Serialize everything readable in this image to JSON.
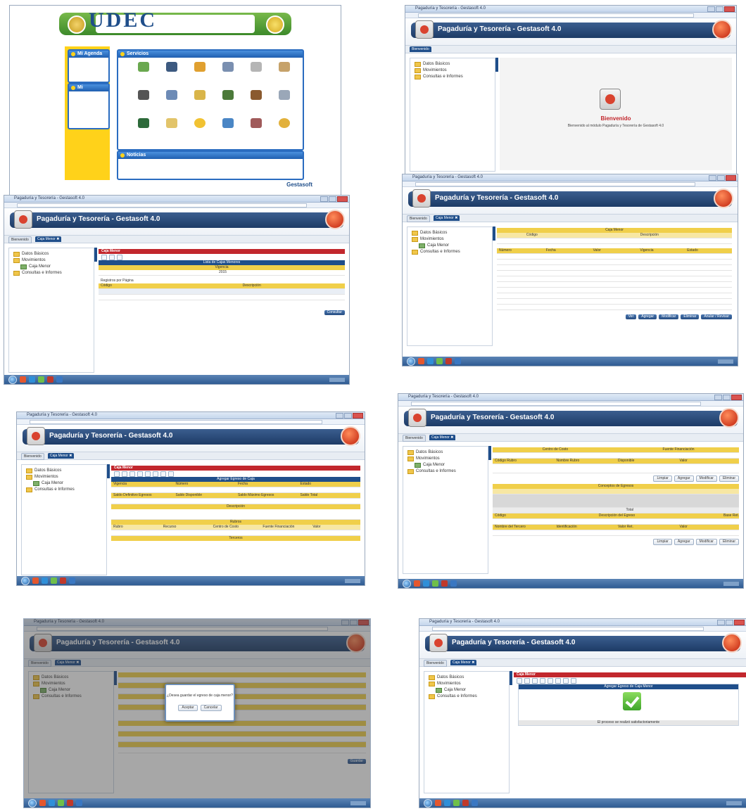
{
  "shot1": {
    "logo_text": "UDEC",
    "portlet_agenda": "Mi Agenda",
    "portlet_calendar": "Mi Calendario",
    "portlet_services": "Servicios",
    "portlet_notices": "Noticias",
    "footer_brand": "Gestasoft",
    "tiles": [
      "",
      "",
      "",
      "",
      "",
      "",
      "",
      "",
      "",
      "",
      "",
      "",
      "",
      "",
      "",
      "",
      "",
      ""
    ]
  },
  "app": {
    "title": "Pagaduría y Tesorería - Gestasoft 4.0",
    "tab_bienvenido": "Bienvenido",
    "tab_caja_menor": "Caja Menor ✖",
    "tree": [
      "Datos Básicos",
      "Movimientos",
      "Caja Menor",
      "Consultas e Informes"
    ]
  },
  "shot2": {
    "welcome_title": "Bienvenido",
    "welcome_text": "Bienvenido al módulo Pagaduría y Tesorería de Gestasoft 4.0"
  },
  "shot3": {
    "band": "Caja Menor",
    "list_title": "Lista de Cajas Menores",
    "col_vigencia": "Vigencia",
    "vigencia_value": "2015",
    "col_codigo": "Código",
    "col_descripcion": "Descripción",
    "registros_label": "Registros por Página",
    "btn_consultar": "Consultar"
  },
  "shot4": {
    "band": "Caja Menor",
    "col_codigo": "Código",
    "col_descripcion": "Descripción",
    "table_headers": [
      "Número",
      "Fecha",
      "Valor",
      "Vigencia",
      "Estado"
    ],
    "buttons": [
      "Ver",
      "Agregar",
      "Modificar",
      "Eliminar",
      "Anular / Revisar"
    ]
  },
  "shot5": {
    "band": "Caja Menor",
    "form_title": "Agregar Egreso de Caja",
    "headers1": [
      "Vigencia",
      "Número",
      "Fecha",
      "Estado"
    ],
    "headers2": [
      "Saldo Definitivo Egresos",
      "Saldo Disponible",
      "Saldo Máximo Egresos",
      "Saldo Total"
    ],
    "detalle": "Descripción",
    "rubros": "Rubros",
    "rubros_cols": [
      "Rubro",
      "Recurso",
      "Centro de Costo",
      "Fuente Financiación",
      "Valor"
    ],
    "terceros": "Terceros"
  },
  "shot6": {
    "headers_top": [
      "Centro de Costo",
      "Fuente Financiación"
    ],
    "headers_mid": [
      "Código Rubro",
      "Nombre Rubro",
      "Disponible",
      "Valor"
    ],
    "buttons": [
      "Limpiar",
      "Agregar",
      "Modificar",
      "Eliminar"
    ],
    "concepts_title": "Conceptos de Egresos",
    "totals_label": "Total",
    "sub_headers": [
      "Código",
      "Descripción del Egreso",
      "Base Ret."
    ],
    "bottom_headers": [
      "Nombre del Tercero",
      "Identificación",
      "Valor Ret.",
      "Valor"
    ]
  },
  "shot7": {
    "dialog_question": "¿Desea guardar el egreso de caja menor?",
    "dialog_ok": "Aceptar",
    "dialog_cancel": "Cancelar",
    "btn_guardar": "Guardar"
  },
  "shot8": {
    "band": "Caja Menor",
    "success_title": "Agregar Egreso de Caja Menor",
    "success_text": "El proceso se realizó satisfactoriamente"
  }
}
